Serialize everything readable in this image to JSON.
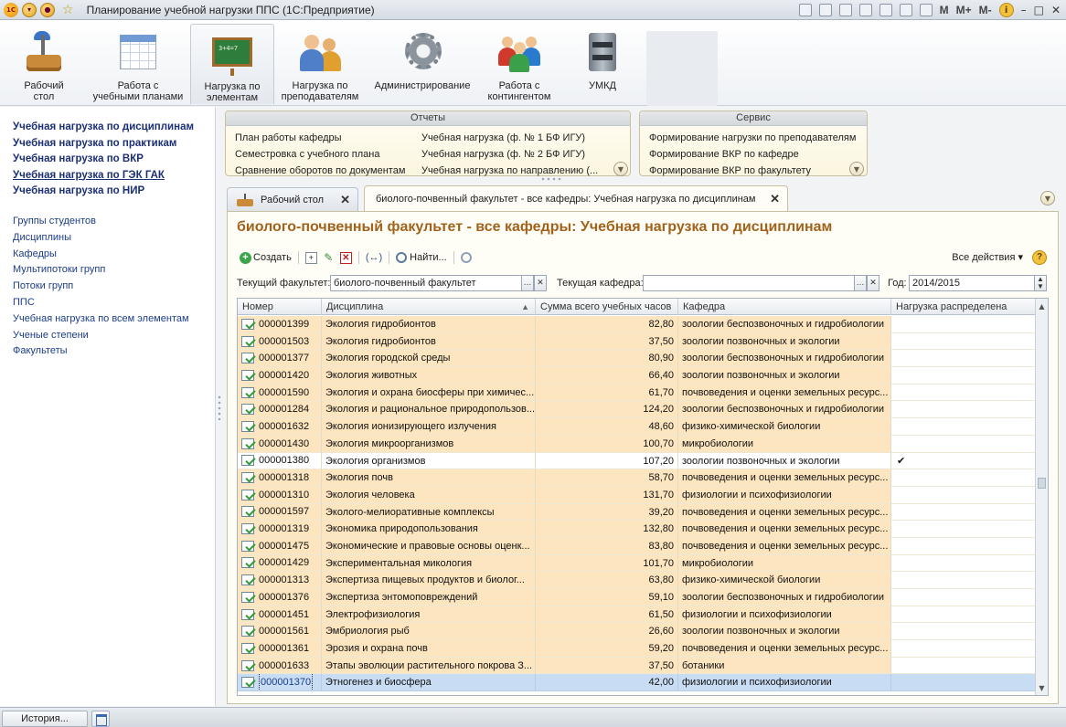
{
  "window": {
    "title": "Планирование учебной нагрузки ППС  (1С:Предприятие)",
    "memory_buttons": [
      "M",
      "M+",
      "M-"
    ],
    "controls": [
      "–",
      "□",
      "✕"
    ]
  },
  "sections": [
    {
      "line1": "Рабочий",
      "line2": "стол",
      "icon": "desk-icon"
    },
    {
      "line1": "Работа с",
      "line2": "учебными планами",
      "icon": "plan-icon"
    },
    {
      "line1": "Нагрузка по",
      "line2": "элементам",
      "icon": "blackboard-icon",
      "active": true
    },
    {
      "line1": "Нагрузка по",
      "line2": "преподавателям",
      "icon": "teachers-icon"
    },
    {
      "line1": "Администрирование",
      "line2": "",
      "icon": "gear-icon"
    },
    {
      "line1": "Работа с",
      "line2": "контингентом",
      "icon": "group-icon"
    },
    {
      "line1": "УМКД",
      "line2": "",
      "icon": "cabinet-icon"
    }
  ],
  "nav_main": [
    "Учебная нагрузка по дисциплинам",
    "Учебная нагрузка по практикам",
    "Учебная нагрузка по ВКР",
    "Учебная нагрузка по ГЭК ГАК",
    "Учебная нагрузка по НИР"
  ],
  "nav_sub": [
    "Группы студентов",
    "Дисциплины",
    "Кафедры",
    "Мультипотоки групп",
    "Потоки групп",
    "ППС",
    "Учебная нагрузка по всем элементам",
    "Ученые степени",
    "Факультеты"
  ],
  "reports": {
    "title": "Отчеты",
    "col1": [
      "План работы кафедры",
      "Семестровка с учебного плана",
      "Сравнение оборотов по документам"
    ],
    "col2": [
      "Учебная нагрузка (ф. № 1 БФ ИГУ)",
      "Учебная нагрузка (ф. № 2 БФ ИГУ)",
      "Учебная нагрузка по направлению (..."
    ]
  },
  "service": {
    "title": "Сервис",
    "items": [
      "Формирование нагрузки по преподавателям",
      "Формирование ВКР по кафедре",
      "Формирование ВКР по факультету"
    ]
  },
  "tabs": [
    {
      "label": "Рабочий стол"
    },
    {
      "label": "биолого-почвенный факультет - все кафедры: Учебная нагрузка по дисциплинам"
    }
  ],
  "form": {
    "title": "биолого-почвенный факультет - все кафедры: Учебная нагрузка по дисциплинам",
    "create_label": "Создать",
    "find_label": "Найти...",
    "all_actions_label": "Все действия",
    "faculty_label": "Текущий факультет:",
    "faculty_value": "биолого-почвенный факультет",
    "department_label": "Текущая кафедра:",
    "department_value": "",
    "year_label": "Год:",
    "year_value": "2014/2015"
  },
  "table": {
    "columns": [
      "Номер",
      "Дисциплина",
      "Сумма всего учебных часов",
      "Кафедра",
      "Нагрузка распределена"
    ],
    "rows": [
      {
        "num": "000001399",
        "disc": "Экология гидробионтов",
        "hours": "82,80",
        "dept": "зоологии беспозвоночных и гидробиологии",
        "done": ""
      },
      {
        "num": "000001503",
        "disc": "Экология гидробионтов",
        "hours": "37,50",
        "dept": "зоологии позвоночных и экологии",
        "done": ""
      },
      {
        "num": "000001377",
        "disc": "Экология городской среды",
        "hours": "80,90",
        "dept": "зоологии беспозвоночных и гидробиологии",
        "done": ""
      },
      {
        "num": "000001420",
        "disc": "Экология животных",
        "hours": "66,40",
        "dept": "зоологии позвоночных и экологии",
        "done": ""
      },
      {
        "num": "000001590",
        "disc": "Экология и охрана биосферы при химичес...",
        "hours": "61,70",
        "dept": "почвоведения и оценки земельных ресурс...",
        "done": ""
      },
      {
        "num": "000001284",
        "disc": "Экология и рациональное природопользов...",
        "hours": "124,20",
        "dept": "зоологии беспозвоночных и гидробиологии",
        "done": ""
      },
      {
        "num": "000001632",
        "disc": "Экология ионизирующего излучения",
        "hours": "48,60",
        "dept": "физико-химической биологии",
        "done": ""
      },
      {
        "num": "000001430",
        "disc": "Экология микроорганизмов",
        "hours": "100,70",
        "dept": "микробиологии",
        "done": ""
      },
      {
        "num": "000001380",
        "disc": "Экология организмов",
        "hours": "107,20",
        "dept": "зоологии позвоночных и экологии",
        "done": "✔",
        "white": true
      },
      {
        "num": "000001318",
        "disc": "Экология почв",
        "hours": "58,70",
        "dept": "почвоведения и оценки земельных ресурс...",
        "done": ""
      },
      {
        "num": "000001310",
        "disc": "Экология человека",
        "hours": "131,70",
        "dept": "физиологии и психофизиологии",
        "done": ""
      },
      {
        "num": "000001597",
        "disc": "Эколого-мелиоративные комплексы",
        "hours": "39,20",
        "dept": "почвоведения и оценки земельных ресурс...",
        "done": ""
      },
      {
        "num": "000001319",
        "disc": "Экономика природопользования",
        "hours": "132,80",
        "dept": "почвоведения и оценки земельных ресурс...",
        "done": ""
      },
      {
        "num": "000001475",
        "disc": "Экономические и правовые основы оценк...",
        "hours": "83,80",
        "dept": "почвоведения и оценки земельных ресурс...",
        "done": ""
      },
      {
        "num": "000001429",
        "disc": "Экспериментальная микология",
        "hours": "101,70",
        "dept": "микробиологии",
        "done": ""
      },
      {
        "num": "000001313",
        "disc": "Экспертиза пищевых  продуктов и биолог...",
        "hours": "63,80",
        "dept": "физико-химической биологии",
        "done": ""
      },
      {
        "num": "000001376",
        "disc": "Экспертиза энтомоповреждений",
        "hours": "59,10",
        "dept": "зоологии беспозвоночных и гидробиологии",
        "done": ""
      },
      {
        "num": "000001451",
        "disc": "Электрофизиология",
        "hours": "61,50",
        "dept": "физиологии и психофизиологии",
        "done": ""
      },
      {
        "num": "000001561",
        "disc": "Эмбриология рыб",
        "hours": "26,60",
        "dept": "зоологии позвоночных и экологии",
        "done": ""
      },
      {
        "num": "000001361",
        "disc": "Эрозия и охрана почв",
        "hours": "59,20",
        "dept": "почвоведения и оценки земельных ресурс...",
        "done": ""
      },
      {
        "num": "000001633",
        "disc": "Этапы эволюции растительного покрова З...",
        "hours": "37,50",
        "dept": "ботаники",
        "done": ""
      },
      {
        "num": "000001370",
        "disc": "Этногенез и биосфера",
        "hours": "42,00",
        "dept": "физиологии и психофизиологии",
        "done": "",
        "selected": true
      }
    ]
  },
  "statusbar": {
    "history_label": "История..."
  },
  "colors": {
    "accent_title": "#a2621b",
    "row_highlight": "#fce5bf",
    "selected_row": "#c8dcf4",
    "nav_link": "#1b2f78"
  }
}
